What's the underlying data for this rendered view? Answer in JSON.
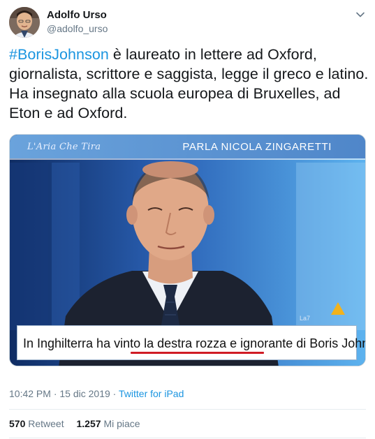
{
  "author": {
    "name": "Adolfo Urso",
    "handle": "@adolfo_urso"
  },
  "tweet": {
    "hashtag": "#BorisJohnson",
    "text": " è laureato in lettere ad Oxford, giornalista, scrittore e saggista, legge il greco e latino. Ha insegnato alla scuola europea di Bruxelles, ad Eton e ad Oxford."
  },
  "media": {
    "show_title": "L'Aria Che Tira",
    "speaker_title": "PARLA NICOLA ZINGARETTI",
    "caption": {
      "before": "In Inghilterra ha vinto ",
      "highlight": "la destra rozza e ignorante",
      "after": " di Boris Johnson."
    }
  },
  "meta": {
    "time": "10:42 PM",
    "separator1": " · ",
    "date": "15 dic 2019",
    "separator2": " · ",
    "source": "Twitter for iPad"
  },
  "stats": {
    "retweets_count": "570",
    "retweets_label": "Retweet",
    "likes_count": "1.257",
    "likes_label": "Mi piace"
  },
  "colors": {
    "link": "#1b95e0",
    "secondary_text": "#657786",
    "primary_text": "#14171a",
    "underline": "#d01c25"
  }
}
